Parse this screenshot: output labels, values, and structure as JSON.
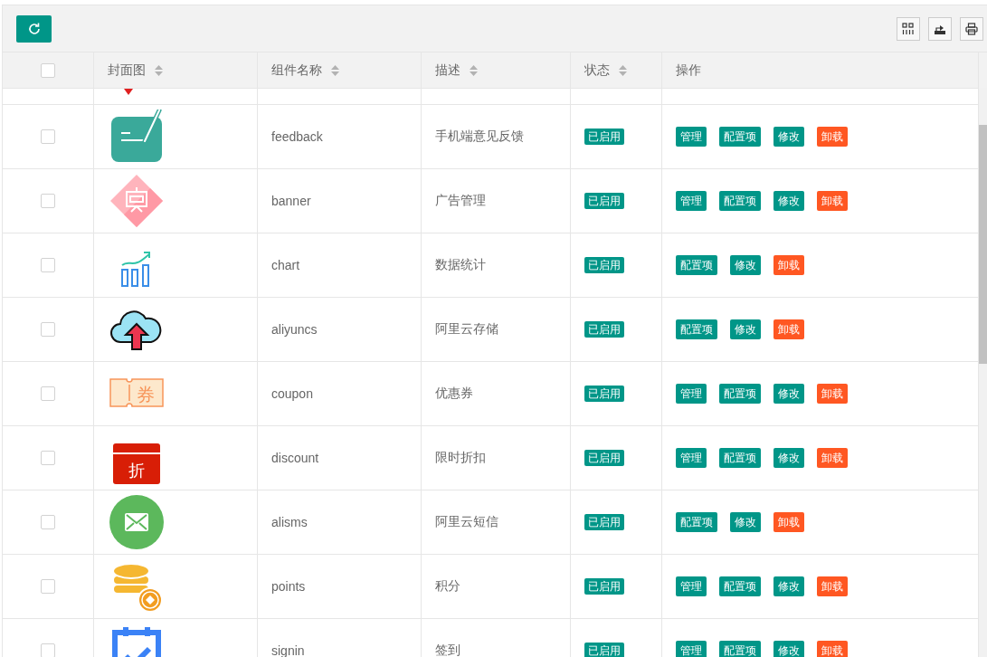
{
  "columns": [
    {
      "label": "封面图",
      "sortable": true
    },
    {
      "label": "组件名称",
      "sortable": true
    },
    {
      "label": "描述",
      "sortable": true
    },
    {
      "label": "状态",
      "sortable": true
    },
    {
      "label": "操作"
    }
  ],
  "header_checkbox": {
    "checked": false
  },
  "rows": [
    {
      "checked": false,
      "name": "feedback",
      "description": "手机端意见反馈",
      "status": "已启用",
      "actions": [
        {
          "label": "管理",
          "kind": "primary"
        },
        {
          "label": "配置项",
          "kind": "primary"
        },
        {
          "label": "修改",
          "kind": "primary"
        },
        {
          "label": "卸载",
          "kind": "danger"
        }
      ]
    },
    {
      "checked": false,
      "name": "banner",
      "description": "广告管理",
      "status": "已启用",
      "actions": [
        {
          "label": "管理",
          "kind": "primary"
        },
        {
          "label": "配置项",
          "kind": "primary"
        },
        {
          "label": "修改",
          "kind": "primary"
        },
        {
          "label": "卸载",
          "kind": "danger"
        }
      ]
    },
    {
      "checked": false,
      "name": "chart",
      "description": "数据统计",
      "status": "已启用",
      "actions": [
        {
          "label": "配置项",
          "kind": "primary"
        },
        {
          "label": "修改",
          "kind": "primary"
        },
        {
          "label": "卸载",
          "kind": "danger"
        }
      ]
    },
    {
      "checked": false,
      "name": "aliyuncs",
      "description": "阿里云存储",
      "status": "已启用",
      "actions": [
        {
          "label": "配置项",
          "kind": "primary"
        },
        {
          "label": "修改",
          "kind": "primary"
        },
        {
          "label": "卸载",
          "kind": "danger"
        }
      ]
    },
    {
      "checked": false,
      "icon_label": "券",
      "name": "coupon",
      "description": "优惠券",
      "status": "已启用",
      "actions": [
        {
          "label": "管理",
          "kind": "primary"
        },
        {
          "label": "配置项",
          "kind": "primary"
        },
        {
          "label": "修改",
          "kind": "primary"
        },
        {
          "label": "卸载",
          "kind": "danger"
        }
      ]
    },
    {
      "checked": false,
      "icon_label": "折",
      "name": "discount",
      "description": "限时折扣",
      "status": "已启用",
      "actions": [
        {
          "label": "管理",
          "kind": "primary"
        },
        {
          "label": "配置项",
          "kind": "primary"
        },
        {
          "label": "修改",
          "kind": "primary"
        },
        {
          "label": "卸载",
          "kind": "danger"
        }
      ]
    },
    {
      "checked": false,
      "name": "alisms",
      "description": "阿里云短信",
      "status": "已启用",
      "actions": [
        {
          "label": "配置项",
          "kind": "primary"
        },
        {
          "label": "修改",
          "kind": "primary"
        },
        {
          "label": "卸载",
          "kind": "danger"
        }
      ]
    },
    {
      "checked": false,
      "name": "points",
      "description": "积分",
      "status": "已启用",
      "actions": [
        {
          "label": "管理",
          "kind": "primary"
        },
        {
          "label": "配置项",
          "kind": "primary"
        },
        {
          "label": "修改",
          "kind": "primary"
        },
        {
          "label": "卸载",
          "kind": "danger"
        }
      ]
    },
    {
      "checked": false,
      "name": "signin",
      "description": "签到",
      "status": "已启用",
      "actions": [
        {
          "label": "管理",
          "kind": "primary"
        },
        {
          "label": "配置项",
          "kind": "primary"
        },
        {
          "label": "修改",
          "kind": "primary"
        },
        {
          "label": "卸载",
          "kind": "danger"
        }
      ]
    }
  ]
}
